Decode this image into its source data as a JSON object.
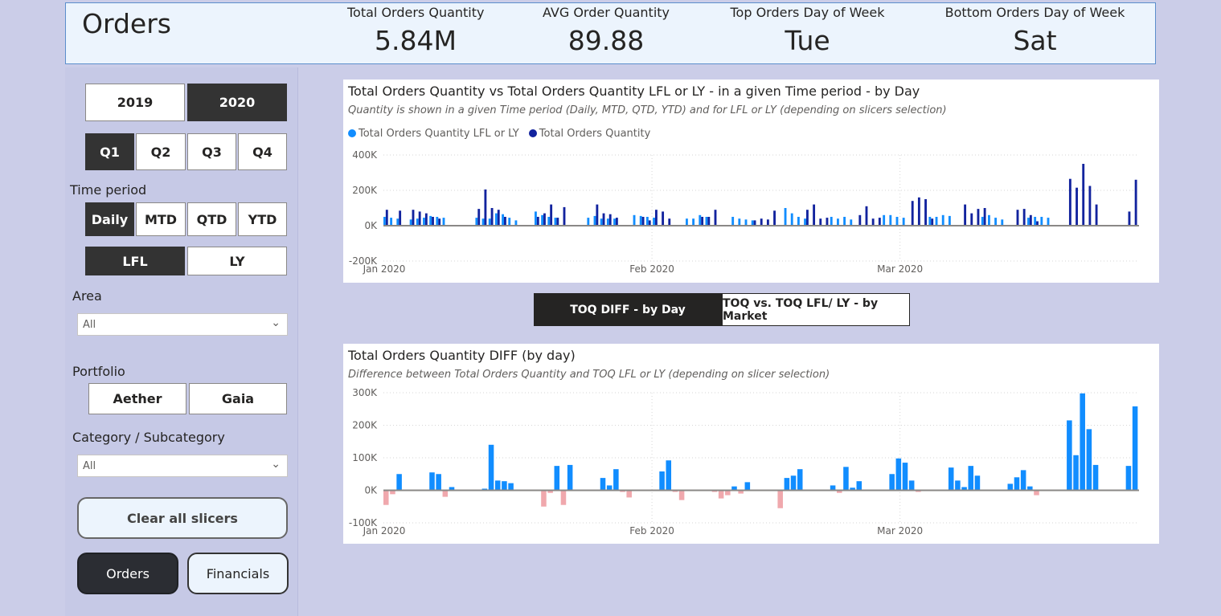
{
  "header": {
    "title": "Orders",
    "kpis": [
      {
        "label": "Total Orders Quantity",
        "value": "5.84M"
      },
      {
        "label": "AVG Order Quantity",
        "value": "89.88"
      },
      {
        "label": "Top Orders Day of Week",
        "value": "Tue"
      },
      {
        "label": "Bottom Orders Day of Week",
        "value": "Sat"
      }
    ]
  },
  "slicers": {
    "years": [
      "2019",
      "2020"
    ],
    "selected_year": "2020",
    "quarters": [
      "Q1",
      "Q2",
      "Q3",
      "Q4"
    ],
    "selected_quarter": "Q1",
    "time_period_label": "Time period",
    "time_periods": [
      "Daily",
      "MTD",
      "QTD",
      "YTD"
    ],
    "selected_time_period": "Daily",
    "comparison": [
      "LFL",
      "LY"
    ],
    "selected_comparison": "LFL",
    "area_label": "Area",
    "area_value": "All",
    "portfolio_label": "Portfolio",
    "portfolios": [
      "Aether",
      "Gaia"
    ],
    "category_label": "Category / Subcategory",
    "category_value": "All",
    "clear_label": "Clear all slicers",
    "nav": [
      "Orders",
      "Financials"
    ]
  },
  "tabs": [
    "TOQ DIFF - by Day",
    "TOQ vs. TOQ LFL/ LY - by Market"
  ],
  "colors": {
    "lfl": "#118dff",
    "toq": "#12239e",
    "diff_pos": "#118dff",
    "diff_neg": "#f0a8ad",
    "selected": "#333333"
  },
  "chart_data": [
    {
      "type": "bar",
      "title": "Total Orders Quantity vs Total Orders Quantity LFL or LY - in a given Time period - by Day",
      "subtitle": "Quantity is shown in a given Time period (Daily, MTD, QTD, YTD) and for LFL or LY (depending on slicers selection)",
      "x_ticks": [
        "Jan 2020",
        "Feb 2020",
        "Mar 2020"
      ],
      "y_ticks": [
        "400K",
        "200K",
        "0K",
        "-200K"
      ],
      "ylim": [
        -200000,
        400000
      ],
      "grid": true,
      "legend_position": "top-left",
      "series": [
        {
          "name": "Total Orders Quantity LFL or LY",
          "values": [
            50000,
            45000,
            40000,
            0,
            35000,
            40000,
            45000,
            55000,
            50000,
            45000,
            0,
            0,
            0,
            0,
            45000,
            40000,
            40000,
            70000,
            65000,
            45000,
            30000,
            0,
            0,
            80000,
            60000,
            50000,
            45000,
            0,
            0,
            0,
            0,
            45000,
            55000,
            40000,
            40000,
            40000,
            0,
            0,
            60000,
            55000,
            50000,
            45000,
            0,
            0,
            0,
            0,
            40000,
            40000,
            60000,
            50000,
            0,
            0,
            0,
            50000,
            40000,
            35000,
            30000,
            0,
            0,
            0,
            0,
            100000,
            70000,
            50000,
            40000,
            0,
            0,
            0,
            50000,
            40000,
            50000,
            35000,
            0,
            0,
            0,
            0,
            60000,
            60000,
            50000,
            45000,
            0,
            0,
            0,
            50000,
            50000,
            60000,
            55000,
            0,
            0,
            0,
            0,
            50000,
            60000,
            45000,
            35000,
            0,
            0,
            0,
            45000,
            50000,
            50000,
            45000,
            0,
            0,
            0,
            0
          ]
        },
        {
          "name": "Total Orders Quantity",
          "values": [
            90000,
            0,
            85000,
            0,
            90000,
            80000,
            70000,
            50000,
            40000,
            0,
            0,
            0,
            0,
            0,
            95000,
            205000,
            100000,
            90000,
            50000,
            0,
            0,
            0,
            0,
            50000,
            70000,
            120000,
            45000,
            105000,
            0,
            0,
            0,
            0,
            120000,
            70000,
            65000,
            45000,
            0,
            0,
            0,
            50000,
            30000,
            90000,
            80000,
            40000,
            0,
            0,
            0,
            0,
            50000,
            50000,
            90000,
            0,
            0,
            0,
            0,
            0,
            30000,
            40000,
            35000,
            85000,
            0,
            0,
            0,
            0,
            90000,
            120000,
            40000,
            45000,
            0,
            0,
            0,
            0,
            60000,
            110000,
            40000,
            45000,
            0,
            0,
            0,
            0,
            140000,
            160000,
            150000,
            40000,
            0,
            0,
            0,
            0,
            120000,
            70000,
            95000,
            100000,
            0,
            0,
            0,
            0,
            90000,
            95000,
            60000,
            25000,
            0,
            0,
            0,
            0,
            265000,
            215000,
            350000,
            225000,
            120000,
            0,
            0,
            0,
            0,
            80000,
            260000
          ]
        }
      ]
    },
    {
      "type": "bar",
      "title": "Total Orders Quantity DIFF (by day)",
      "subtitle": "Difference between Total Orders Quantity and TOQ LFL or LY (depending on slicer selection)",
      "x_ticks": [
        "Jan 2020",
        "Feb 2020",
        "Mar 2020"
      ],
      "y_ticks": [
        "300K",
        "200K",
        "100K",
        "0K",
        "-100K"
      ],
      "ylim": [
        -100000,
        300000
      ],
      "grid": true,
      "values": [
        -45000,
        -12000,
        50000,
        0,
        0,
        0,
        0,
        55000,
        50000,
        -20000,
        10000,
        0,
        0,
        0,
        0,
        5000,
        140000,
        30000,
        28000,
        22000,
        0,
        0,
        0,
        0,
        -50000,
        -8000,
        75000,
        -45000,
        78000,
        0,
        0,
        0,
        0,
        38000,
        15000,
        65000,
        -5000,
        -22000,
        0,
        0,
        0,
        0,
        58000,
        92000,
        -5000,
        -30000,
        0,
        0,
        0,
        0,
        -5000,
        -25000,
        -15000,
        12000,
        -10000,
        25000,
        0,
        0,
        0,
        0,
        -55000,
        38000,
        45000,
        65000,
        0,
        0,
        0,
        0,
        15000,
        -8000,
        72000,
        8000,
        28000,
        0,
        0,
        0,
        0,
        50000,
        98000,
        85000,
        30000,
        -5000,
        0,
        0,
        0,
        0,
        70000,
        30000,
        10000,
        75000,
        45000,
        0,
        0,
        0,
        0,
        20000,
        40000,
        62000,
        12000,
        -15000,
        0,
        0,
        0,
        0,
        215000,
        108000,
        298000,
        188000,
        78000,
        0,
        0,
        0,
        0,
        75000,
        258000
      ]
    }
  ]
}
